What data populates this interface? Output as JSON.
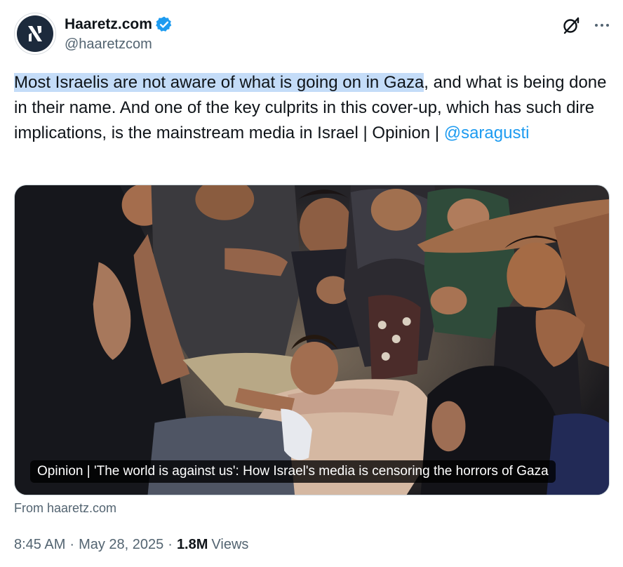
{
  "author": {
    "display_name": "Haaretz.com",
    "handle": "@haaretzcom",
    "verified": true,
    "avatar_icon": "haaretz-logo"
  },
  "actions": {
    "grok_icon": "grok-icon",
    "more_icon": "more-icon"
  },
  "tweet": {
    "highlighted_text": "Most Israelis are not aware of what is going on in Gaza",
    "text_rest": ", and what is being done in their name. And one of the key culprits in this cover-up, which has such dire implications, is the mainstream media in Israel | Opinion | ",
    "mention": "@saragusti"
  },
  "card": {
    "caption": "Opinion | 'The world is against us': How Israel's media is censoring the horrors of Gaza",
    "source": "From haaretz.com"
  },
  "meta": {
    "time": "8:45 AM",
    "date": "May 28, 2025",
    "views_count": "1.8M",
    "views_label": "Views"
  },
  "colors": {
    "accent": "#1d9bf0",
    "highlight": "#c4dcf8",
    "avatar_bg": "#1c2a3c",
    "secondary_text": "#536471"
  }
}
